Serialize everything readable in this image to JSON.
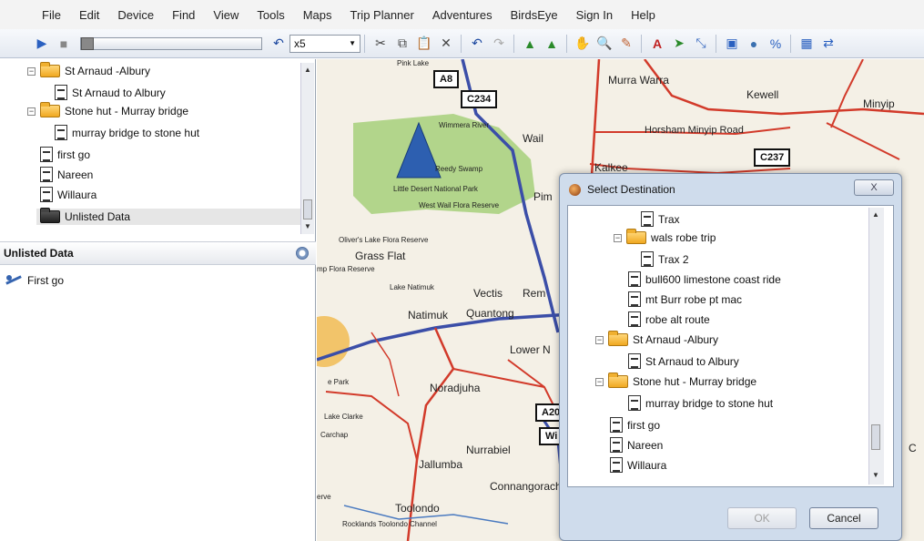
{
  "menubar": {
    "items": [
      "File",
      "Edit",
      "Device",
      "Find",
      "View",
      "Tools",
      "Maps",
      "Trip Planner",
      "Adventures",
      "BirdsEye",
      "Sign In",
      "Help"
    ]
  },
  "toolbar": {
    "speed_value": "x5",
    "playback_progress": 0
  },
  "left_tree": {
    "items": [
      {
        "label": "St Arnaud -Albury",
        "type": "folder"
      },
      {
        "label": "St Arnaud to Albury",
        "type": "route"
      },
      {
        "label": "Stone hut - Murray bridge",
        "type": "folder"
      },
      {
        "label": "murray bridge to stone hut",
        "type": "route"
      },
      {
        "label": "first go",
        "type": "route"
      },
      {
        "label": "Nareen",
        "type": "route"
      },
      {
        "label": "Willaura",
        "type": "route"
      },
      {
        "label": "Unlisted Data",
        "type": "folder-dark"
      }
    ]
  },
  "unlisted_panel": {
    "title": "Unlisted Data",
    "items": [
      {
        "label": "First go"
      }
    ]
  },
  "map": {
    "towns": [
      "Murra Warra",
      "Kewell",
      "Minyip",
      "Wail",
      "Horsham Minyip Road",
      "Kalkee",
      "Wimmera River",
      "Reedy Swamp",
      "Little Desert National Park",
      "West Wail Flora Reserve",
      "Pim",
      "Oliver's Lake Flora Reserve",
      "Grass Flat",
      "mp Flora Reserve",
      "Lake Natimuk",
      "Vectis",
      "Rem",
      "Natimuk",
      "Quantong",
      "Lower N",
      "e Park",
      "Noradjuha",
      "Lake Clarke",
      "Carchap",
      "Nurrabiel",
      "Jallumba",
      "Connangorach",
      "Toolondo",
      "Rocklands Toolondo Channel",
      "Pink Lake",
      "C",
      "erve"
    ],
    "shields": [
      "A8",
      "C234",
      "C237",
      "A20",
      "Wi"
    ]
  },
  "dialog": {
    "title": "Select Destination",
    "close_label": "X",
    "items": [
      {
        "label": "Trax",
        "type": "route",
        "indent": 1
      },
      {
        "label": "wals robe trip",
        "type": "folder",
        "indent": 0
      },
      {
        "label": "Trax 2",
        "type": "route",
        "indent": 1
      },
      {
        "label": "bull600 limestone coast ride",
        "type": "route",
        "indent": 0
      },
      {
        "label": "mt Burr robe pt mac",
        "type": "route",
        "indent": 0
      },
      {
        "label": "robe alt route",
        "type": "route",
        "indent": 0
      },
      {
        "label": "St Arnaud -Albury",
        "type": "folder",
        "indent": 0
      },
      {
        "label": "St Arnaud to Albury",
        "type": "route",
        "indent": 1
      },
      {
        "label": "Stone hut - Murray bridge",
        "type": "folder",
        "indent": 0
      },
      {
        "label": "murray bridge to stone hut",
        "type": "route",
        "indent": 1
      },
      {
        "label": "first go",
        "type": "route",
        "indent": 0
      },
      {
        "label": "Nareen",
        "type": "route",
        "indent": 0
      },
      {
        "label": "Willaura",
        "type": "route",
        "indent": 0
      }
    ],
    "ok_label": "OK",
    "cancel_label": "Cancel"
  },
  "colors": {
    "road_major": "#d23a2a",
    "road_highway": "#3b4ea8",
    "park_green": "#a6d07a",
    "dialog_frame": "#cfdcec",
    "position_marker": "#2d5fb0"
  }
}
